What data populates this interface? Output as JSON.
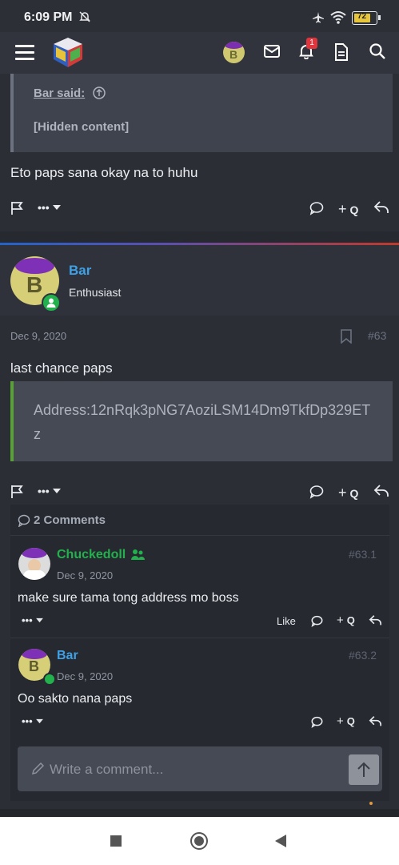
{
  "status_bar": {
    "time": "6:09 PM",
    "battery": "72"
  },
  "header": {
    "menu_icon": "hamburger-icon",
    "logo_icon": "cube-logo",
    "avatar_letter": "B",
    "notification_count": "1"
  },
  "quote": {
    "author": "Bar said:",
    "content": "[Hidden content]"
  },
  "prev_post": {
    "text": "Eto paps sana okay na to huhu"
  },
  "actions": {
    "more": "•••",
    "quote": "Q"
  },
  "post": {
    "avatar_letter": "B",
    "author": "Bar",
    "user_title": "Enthusiast",
    "date": "Dec 9, 2020",
    "number": "#63",
    "text": "last chance paps",
    "code": "Address:12nRqk3pNG7AoziLSM14Dm9TkfDp329ETz"
  },
  "comments": {
    "header": "2 Comments",
    "items": [
      {
        "author": "Chuckedoll",
        "date": "Dec 9, 2020",
        "number": "#63.1",
        "text": "make sure tama tong address mo boss",
        "like_label": "Like"
      },
      {
        "author": "Bar",
        "avatar_letter": "B",
        "date": "Dec 9, 2020",
        "number": "#63.2",
        "text": "Oo sakto nana paps"
      }
    ],
    "write_placeholder": "Write a comment..."
  },
  "colors": {
    "accent_blue": "#3fa0e6",
    "green_user": "#22b14c",
    "code_border": "#5aa135"
  }
}
